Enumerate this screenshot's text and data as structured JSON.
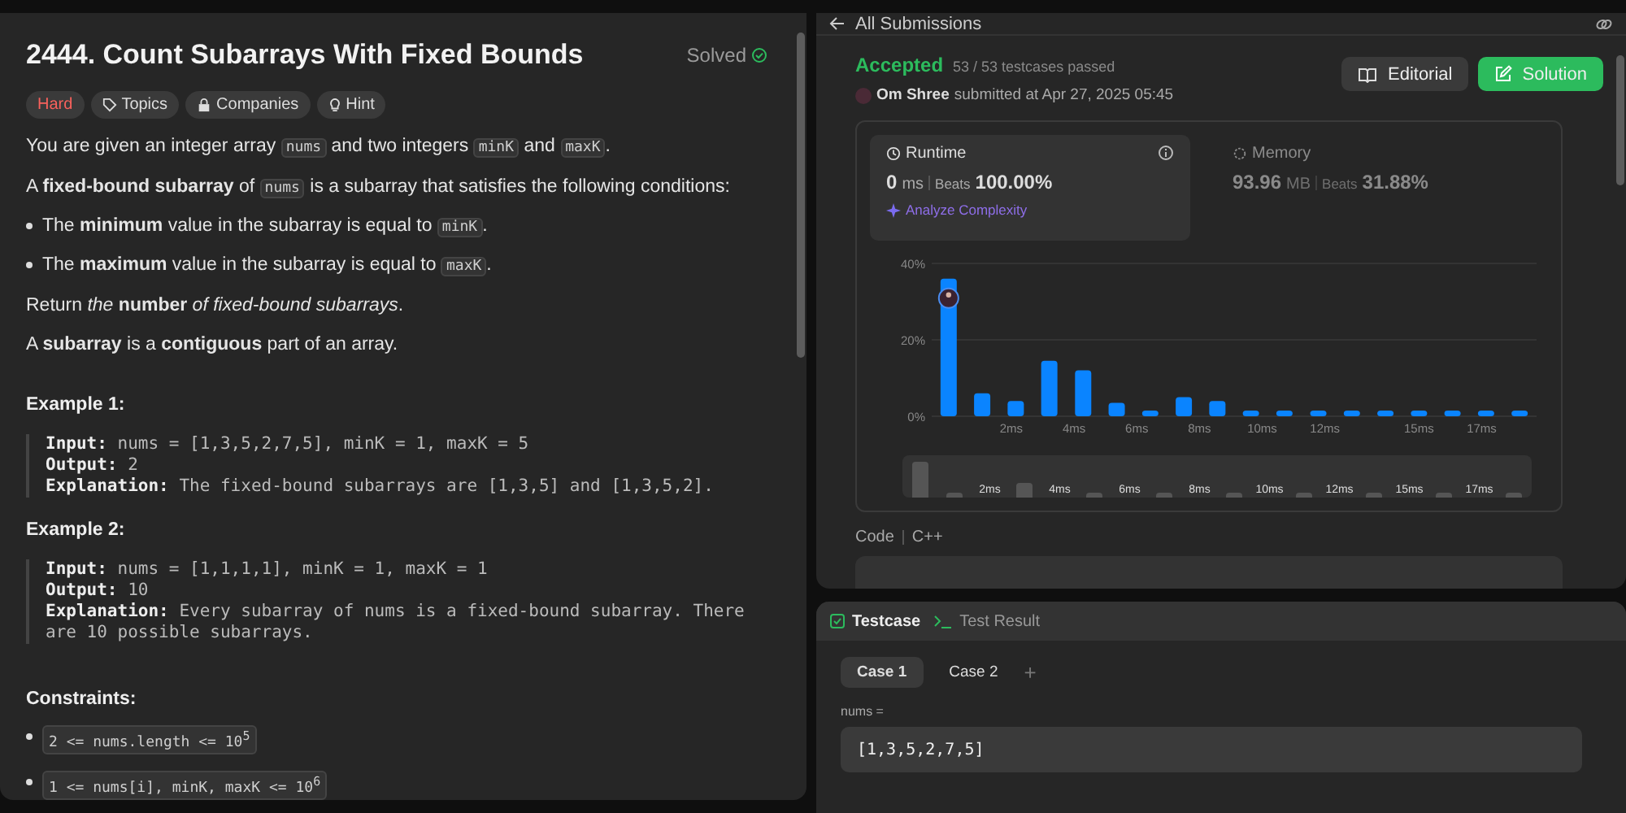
{
  "problem": {
    "title": "2444. Count Subarrays With Fixed Bounds",
    "status": "Solved",
    "solved": true,
    "tags": [
      {
        "kind": "difficulty",
        "label": "Hard"
      },
      {
        "kind": "topics",
        "label": "Topics"
      },
      {
        "kind": "companies",
        "label": "Companies"
      },
      {
        "kind": "hint",
        "label": "Hint"
      }
    ],
    "paragraphs": [
      {
        "kind": "p",
        "parts": [
          {
            "text": "You are given an integer array "
          },
          {
            "code": "nums"
          },
          {
            "text": " and two integers "
          },
          {
            "code": "minK"
          },
          {
            "text": " and "
          },
          {
            "code": "maxK"
          },
          {
            "text": "."
          }
        ]
      },
      {
        "kind": "p",
        "parts": [
          {
            "text": "A **fixed-bound subarray** of "
          },
          {
            "code": "nums"
          },
          {
            "text": " is a subarray that satisfies the following conditions:"
          }
        ]
      },
      {
        "kind": "li",
        "parts": [
          {
            "text": "The **minimum** value in the subarray is equal to "
          },
          {
            "code": "minK"
          },
          {
            "text": "."
          }
        ]
      },
      {
        "kind": "li",
        "parts": [
          {
            "text": "The **maximum** value in the subarray is equal to "
          },
          {
            "code": "maxK"
          },
          {
            "text": "."
          }
        ]
      },
      {
        "kind": "p",
        "parts": [
          {
            "text": "Return *the* **number** *of fixed-bound subarrays*."
          }
        ]
      },
      {
        "kind": "p",
        "parts": [
          {
            "text": "A **subarray** is a **contiguous** part of an array."
          }
        ]
      }
    ],
    "examples": [
      {
        "title": "Example 1:",
        "lines": [
          {
            "label": "Input:",
            "text": "nums = [1,3,5,2,7,5], minK = 1, maxK = 5"
          },
          {
            "label": "Output:",
            "text": "2"
          },
          {
            "label": "Explanation:",
            "text": "The fixed-bound subarrays are [1,3,5] and [1,3,5,2]."
          }
        ]
      },
      {
        "title": "Example 2:",
        "lines": [
          {
            "label": "Input:",
            "text": "nums = [1,1,1,1], minK = 1, maxK = 1"
          },
          {
            "label": "Output:",
            "text": "10"
          },
          {
            "label": "Explanation:",
            "text": "Every subarray of nums is a fixed-bound subarray. There are 10 possible subarrays."
          }
        ]
      }
    ],
    "constraints_title": "Constraints:",
    "constraints": [
      "2 <= nums.length <= 10$^{5}$",
      "1 <= nums[i], minK, maxK <= 10$^{6}$"
    ]
  },
  "submission": {
    "back": "All Submissions",
    "verdict": "Accepted",
    "passed": "53 / 53 testcases passed",
    "author": "Om Shree",
    "submitted": "submitted at Apr 27, 2025 05:45",
    "buttons": [
      {
        "kind": "editorial",
        "label": "Editorial"
      },
      {
        "kind": "solution",
        "label": "Solution"
      }
    ],
    "metrics": [
      {
        "label": "Runtime",
        "selected": true,
        "value": "0",
        "unit": "ms",
        "beats_label": "Beats",
        "beats": "100.00%",
        "analyze": "Analyze Complexity"
      },
      {
        "label": "Memory",
        "selected": false,
        "value": "93.96",
        "unit": "MB",
        "beats_label": "Beats",
        "beats": "31.88%"
      }
    ],
    "chart_data": {
      "type": "bar",
      "x": [
        0,
        1.07,
        2.14,
        3.21,
        4.29,
        5.36,
        6.43,
        7.5,
        8.57,
        9.64,
        10.71,
        11.79,
        12.86,
        13.93,
        15,
        16.07,
        17.14,
        18.21
      ],
      "series": [
        {
          "color": "#0a84ff",
          "values": [
            36,
            6,
            4,
            14.5,
            12,
            3.5,
            1.5,
            5,
            4,
            1.5,
            1.5,
            1.5,
            1.5,
            1.5,
            1.5,
            1.5,
            1.5,
            1.5
          ]
        }
      ],
      "xlim": [
        -0.54,
        18.75
      ],
      "ylim": [
        0,
        40
      ],
      "yticks": [
        {
          "value": 0,
          "label": "0%"
        },
        {
          "value": 20,
          "label": "20%"
        },
        {
          "value": 40,
          "label": "40%"
        }
      ],
      "xticks": [
        {
          "value": 2,
          "label": "2ms"
        },
        {
          "value": 4,
          "label": "4ms"
        },
        {
          "value": 6,
          "label": "6ms"
        },
        {
          "value": 8,
          "label": "8ms"
        },
        {
          "value": 10,
          "label": "10ms"
        },
        {
          "value": 12,
          "label": "12ms"
        },
        {
          "value": 15,
          "label": "15ms"
        },
        {
          "value": 17,
          "label": "17ms"
        }
      ]
    },
    "overview_ticks": [
      "2ms",
      "4ms",
      "6ms",
      "8ms",
      "10ms",
      "12ms",
      "15ms",
      "17ms"
    ],
    "code_label": "Code",
    "language": "C++"
  },
  "console": {
    "tabs": [
      {
        "label": "Testcase",
        "selected": true
      },
      {
        "label": "Test Result",
        "selected": false
      }
    ],
    "cases": [
      {
        "label": "Case 1",
        "selected": true
      },
      {
        "label": "Case 2",
        "selected": false
      }
    ],
    "add": "+",
    "inputs": [
      {
        "name": "nums =",
        "value": "[1,3,5,2,7,5]"
      }
    ]
  }
}
